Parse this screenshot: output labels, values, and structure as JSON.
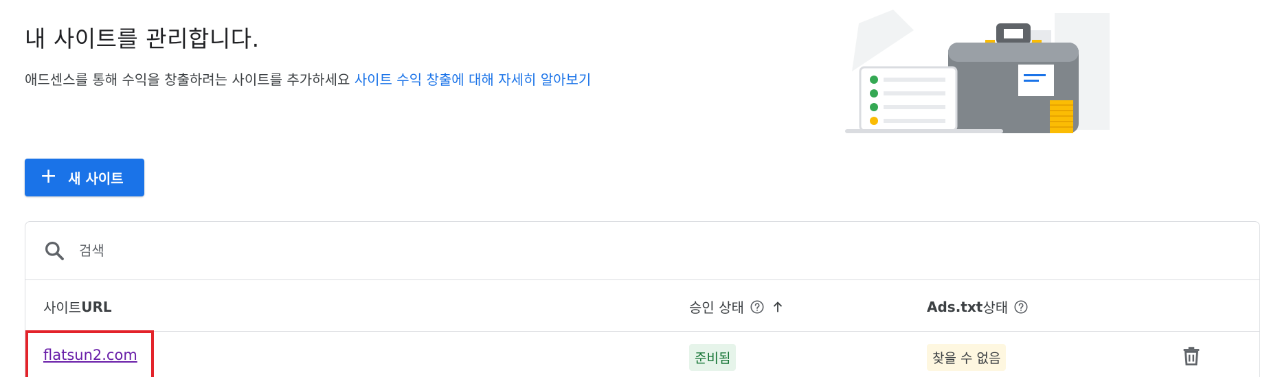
{
  "header": {
    "title": "내 사이트를 관리합니다.",
    "subtitle_text": "애드센스를 통해 수익을 창출하려는 사이트를 추가하세요 ",
    "subtitle_link": "사이트 수익 창출에 대해 자세히 알아보기"
  },
  "toolbar": {
    "new_site_icon": "+",
    "new_site_label": "새 사이트"
  },
  "search": {
    "icon": "search-icon",
    "placeholder": "검색"
  },
  "table": {
    "columns": {
      "url_korean": "사이트 ",
      "url_latin": "URL",
      "approval_status": "승인 상태",
      "ads_txt_latin": "Ads.txt",
      "ads_txt_korean": " 상태"
    },
    "sort_icon": "arrow-up-icon",
    "help_icon": "help-circle-icon",
    "rows": [
      {
        "site_url": "flatsun2.com",
        "approval_status": "준비됨",
        "ads_txt_status": "찾을 수 없음",
        "delete_icon": "trash-icon"
      }
    ]
  },
  "colors": {
    "primary": "#1a73e8",
    "visited_link": "#681da8",
    "highlight_border": "#e3232a",
    "status_green_bg": "#e6f4ea",
    "status_green_text": "#137333",
    "status_yellow_bg": "#fef7e0"
  }
}
